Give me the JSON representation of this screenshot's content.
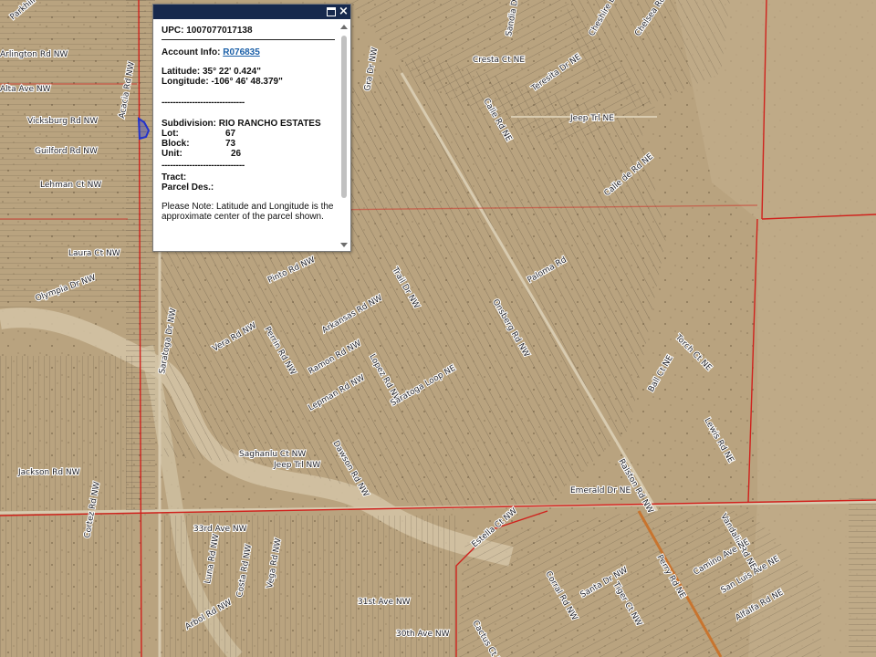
{
  "map": {
    "streets": [
      "Parkhill Dr NW",
      "Arlington Rd NW",
      "Gra Dr NW",
      "Cheshire Dr NE",
      "Chelsea Rd NE",
      "Sandia Dr NW",
      "Acacia Rd NW",
      "Alta Ave NW",
      "Vicksburg Rd NW",
      "Guilford Rd NW",
      "Lehman Ct NW",
      "Cresta Ct NE",
      "Jeep Trl NE",
      "Teresita Dr NE",
      "Calle Rd NE",
      "Laura Ct NW",
      "Olympia Dr NW",
      "Pinto Rd NW",
      "Trail Dr NW",
      "Arkansas Rd NW",
      "Vera Rd NW",
      "Ramon Rd NW",
      "Lopez Rd NW",
      "Saratoga Dr NW",
      "Saratoga Loop NE",
      "Perrin Rd NW",
      "Lepman Rd NW",
      "Onsberg Rd NW",
      "Paloma Rd",
      "Calle de Rd NE",
      "Ball Ct NE",
      "Torch Ct NE",
      "Lewis Rd NE",
      "Saghanlu Ct NW",
      "Jeep Trl NW",
      "Dawson Rd NW",
      "Jackson Rd NW",
      "Emerald Dr NE",
      "Ralston Rd NW",
      "33rd Ave NW",
      "Cortez Rd NW",
      "Estella Ct NW",
      "Costa Rd NW",
      "Vega Rd NW",
      "Luna Rd NW",
      "Arbol Rd NW",
      "Santa Dr NW",
      "Tiger Ct NW",
      "Vandalia Rd NE",
      "Camino Ave NE",
      "San Luis Ave NE",
      "Perry Rd NE",
      "Alfalfa Rd NE",
      "Corral Rd NW",
      "31st Ave NW",
      "30th Ave NW",
      "Cactus Ct NW"
    ]
  },
  "popup": {
    "upc_label": "UPC:",
    "upc_value": "1007077017138",
    "account_label": "Account Info:",
    "account_link": "R076835",
    "latitude_label": "Latitude:",
    "latitude_value": "35° 22' 0.424\"",
    "longitude_label": "Longitude:",
    "longitude_value": "-106° 46' 48.379\"",
    "separator": "------------------------------",
    "subdivision_label": "Subdivision:",
    "subdivision_value": "RIO RANCHO ESTATES",
    "lot_label": "Lot:",
    "lot_value": "67",
    "block_label": "Block:",
    "block_value": "73",
    "unit_label": "Unit:",
    "unit_value": "26",
    "tract_label": "Tract:",
    "parcel_label": "Parcel Des.:",
    "note": "Please Note: Latitude and Longitude is the approximate center of the parcel shown."
  },
  "colors": {
    "terrain": "#b8a07e",
    "parcel_line": "#3a3228",
    "boundary": "#d0211c",
    "highlight": "#2233cc",
    "titlebar": "#17294d",
    "link": "#1a5fa8"
  }
}
